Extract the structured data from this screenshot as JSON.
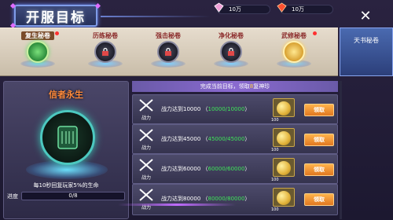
{
  "header": {
    "title": "开服目标",
    "currency": [
      {
        "icon": "diamond-icon",
        "value": "10万"
      },
      {
        "icon": "ruby-icon",
        "value": "10万"
      }
    ],
    "close_icon": "close-icon"
  },
  "tabs": [
    {
      "label": "复生秘卷",
      "active": true,
      "locked": false
    },
    {
      "label": "历练秘卷",
      "active": false,
      "locked": true
    },
    {
      "label": "强击秘卷",
      "active": false,
      "locked": true
    },
    {
      "label": "净化秘卷",
      "active": false,
      "locked": true
    },
    {
      "label": "武修秘卷",
      "active": false,
      "locked": false
    }
  ],
  "side_tab": {
    "label": "天书秘卷"
  },
  "left_panel": {
    "title": "信者永生",
    "description": "每10秒回复玩家5%的生命",
    "progress_label": "进度",
    "progress_text": "0/8",
    "progress_value": 0
  },
  "list": {
    "header_prefix": "完成当前目标，领取",
    "header_highlight": "8",
    "header_suffix": "复神珍",
    "rows": [
      {
        "icon_label": "战力",
        "text_prefix": "战力达到10000",
        "progress": "10000/10000",
        "coin_count": "100",
        "claim_label": "领取"
      },
      {
        "icon_label": "战力",
        "text_prefix": "战力达到45000",
        "progress": "45000/45000",
        "coin_count": "100",
        "claim_label": "领取"
      },
      {
        "icon_label": "战力",
        "text_prefix": "战力达到60000",
        "progress": "60000/60000",
        "coin_count": "100",
        "claim_label": "领取"
      },
      {
        "icon_label": "战力",
        "text_prefix": "战力达到80000",
        "progress": "80000/80000",
        "coin_count": "100",
        "claim_label": "领取"
      }
    ]
  },
  "colors": {
    "accent": "#7f9ce8",
    "progress_green": "#3fe65a",
    "claim_orange": "#e07820",
    "title_orange": "#ff8a3a"
  }
}
